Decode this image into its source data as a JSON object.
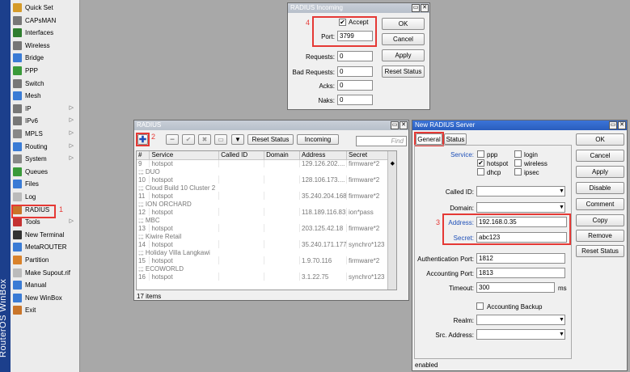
{
  "app": {
    "brand": "RouterOS WinBox"
  },
  "sidebar": {
    "items": [
      {
        "label": "Quick Set",
        "icon": "quick-set-icon",
        "color": "#d59b2a",
        "arrow": false
      },
      {
        "label": "CAPsMAN",
        "icon": "antenna-icon",
        "color": "#777777",
        "arrow": false
      },
      {
        "label": "Interfaces",
        "icon": "interfaces-icon",
        "color": "#2f7d2f",
        "arrow": false
      },
      {
        "label": "Wireless",
        "icon": "wireless-icon",
        "color": "#777777",
        "arrow": false
      },
      {
        "label": "Bridge",
        "icon": "bridge-icon",
        "color": "#3a7bd5",
        "arrow": false
      },
      {
        "label": "PPP",
        "icon": "ppp-icon",
        "color": "#3a9a3a",
        "arrow": false
      },
      {
        "label": "Switch",
        "icon": "switch-icon",
        "color": "#777777",
        "arrow": false
      },
      {
        "label": "Mesh",
        "icon": "mesh-icon",
        "color": "#3a7bd5",
        "arrow": false
      },
      {
        "label": "IP",
        "icon": "ip-icon",
        "color": "#777777",
        "arrow": true
      },
      {
        "label": "IPv6",
        "icon": "ipv6-icon",
        "color": "#777777",
        "arrow": true
      },
      {
        "label": "MPLS",
        "icon": "mpls-icon",
        "color": "#888888",
        "arrow": true
      },
      {
        "label": "Routing",
        "icon": "routing-icon",
        "color": "#3a7bd5",
        "arrow": true
      },
      {
        "label": "System",
        "icon": "gear-icon",
        "color": "#888888",
        "arrow": true
      },
      {
        "label": "Queues",
        "icon": "queues-icon",
        "color": "#3a9a3a",
        "arrow": false
      },
      {
        "label": "Files",
        "icon": "files-icon",
        "color": "#3a7bd5",
        "arrow": false
      },
      {
        "label": "Log",
        "icon": "log-icon",
        "color": "#bbbbbb",
        "arrow": false
      },
      {
        "label": "RADIUS",
        "icon": "radius-icon",
        "color": "#c9752a",
        "arrow": false
      },
      {
        "label": "Tools",
        "icon": "tools-icon",
        "color": "#c43232",
        "arrow": true
      },
      {
        "label": "New Terminal",
        "icon": "terminal-icon",
        "color": "#333333",
        "arrow": false
      },
      {
        "label": "MetaROUTER",
        "icon": "metarouter-icon",
        "color": "#3a7bd5",
        "arrow": false
      },
      {
        "label": "Partition",
        "icon": "partition-icon",
        "color": "#d9822b",
        "arrow": false
      },
      {
        "label": "Make Supout.rif",
        "icon": "supout-icon",
        "color": "#bbbbbb",
        "arrow": false
      },
      {
        "label": "Manual",
        "icon": "manual-icon",
        "color": "#3a7bd5",
        "arrow": false
      },
      {
        "label": "New WinBox",
        "icon": "winbox-icon",
        "color": "#3a7bd5",
        "arrow": false
      },
      {
        "label": "Exit",
        "icon": "exit-icon",
        "color": "#c9752a",
        "arrow": false
      }
    ]
  },
  "annotations": {
    "n1": "1",
    "n2": "2",
    "n3": "3",
    "n4": "4"
  },
  "incoming": {
    "title": "RADIUS Incoming",
    "accept_label": "Accept",
    "accept_checked": true,
    "port_label": "Port:",
    "port_value": "3799",
    "requests_label": "Requests:",
    "requests_value": "0",
    "bad_requests_label": "Bad Requests:",
    "bad_requests_value": "0",
    "acks_label": "Acks:",
    "acks_value": "0",
    "naks_label": "Naks:",
    "naks_value": "0",
    "ok": "OK",
    "cancel": "Cancel",
    "apply": "Apply",
    "reset_status": "Reset Status"
  },
  "radius": {
    "title": "RADIUS",
    "toolbar": {
      "reset_status": "Reset Status",
      "incoming": "Incoming",
      "find_placeholder": "Find"
    },
    "columns": [
      "#",
      "Service",
      "Called ID",
      "Domain",
      "Address",
      "Secret"
    ],
    "rows": [
      {
        "type": "row",
        "cells": [
          "9",
          "hotspot",
          "",
          "",
          "129.126.202....",
          "firmware*2"
        ]
      },
      {
        "type": "comment",
        "text": ";;; DUO"
      },
      {
        "type": "row",
        "cells": [
          "10",
          "hotspot",
          "",
          "",
          "128.106.173....",
          "firmware*2"
        ]
      },
      {
        "type": "comment",
        "text": ";;; Cloud Build 10 Cluster 2"
      },
      {
        "type": "row",
        "cells": [
          "11",
          "hotspot",
          "",
          "",
          "35.240.204.168",
          "firmware*2"
        ]
      },
      {
        "type": "comment",
        "text": ";;; ION ORCHARD"
      },
      {
        "type": "row",
        "cells": [
          "12",
          "hotspot",
          "",
          "",
          "118.189.116.83",
          "ion*pass"
        ]
      },
      {
        "type": "comment",
        "text": ";;; MBC"
      },
      {
        "type": "row",
        "cells": [
          "13",
          "hotspot",
          "",
          "",
          "203.125.42.18",
          "firmware*2"
        ]
      },
      {
        "type": "comment",
        "text": ";;; Kiwire Retail"
      },
      {
        "type": "row",
        "cells": [
          "14",
          "hotspot",
          "",
          "",
          "35.240.171.177",
          "synchro*123"
        ]
      },
      {
        "type": "comment",
        "text": ";;; Holiday Villa Langkawi"
      },
      {
        "type": "row",
        "cells": [
          "15",
          "hotspot",
          "",
          "",
          "1.9.70.116",
          "firmware*2"
        ]
      },
      {
        "type": "comment",
        "text": ";;; ECOWORLD"
      },
      {
        "type": "row",
        "cells": [
          "16",
          "hotspot",
          "",
          "",
          "3.1.22.75",
          "synchro*123"
        ]
      }
    ],
    "status": "17 items"
  },
  "new_server": {
    "title": "New RADIUS Server",
    "tabs": [
      "General",
      "Status"
    ],
    "service_label": "Service:",
    "services": [
      {
        "label": "ppp",
        "checked": false
      },
      {
        "label": "login",
        "checked": false
      },
      {
        "label": "hotspot",
        "checked": true
      },
      {
        "label": "wireless",
        "checked": false
      },
      {
        "label": "dhcp",
        "checked": false
      },
      {
        "label": "ipsec",
        "checked": false
      }
    ],
    "called_id_label": "Called ID:",
    "domain_label": "Domain:",
    "address_label": "Address:",
    "address_value": "192.168.0.35",
    "secret_label": "Secret:",
    "secret_value": "abc123",
    "auth_port_label": "Authentication Port:",
    "auth_port_value": "1812",
    "acct_port_label": "Accounting Port:",
    "acct_port_value": "1813",
    "timeout_label": "Timeout:",
    "timeout_value": "300",
    "timeout_unit": "ms",
    "acct_backup_label": "Accounting Backup",
    "realm_label": "Realm:",
    "src_address_label": "Src. Address:",
    "status_bar": "enabled",
    "buttons": [
      "OK",
      "Cancel",
      "Apply",
      "Disable",
      "Comment",
      "Copy",
      "Remove",
      "Reset Status"
    ]
  }
}
